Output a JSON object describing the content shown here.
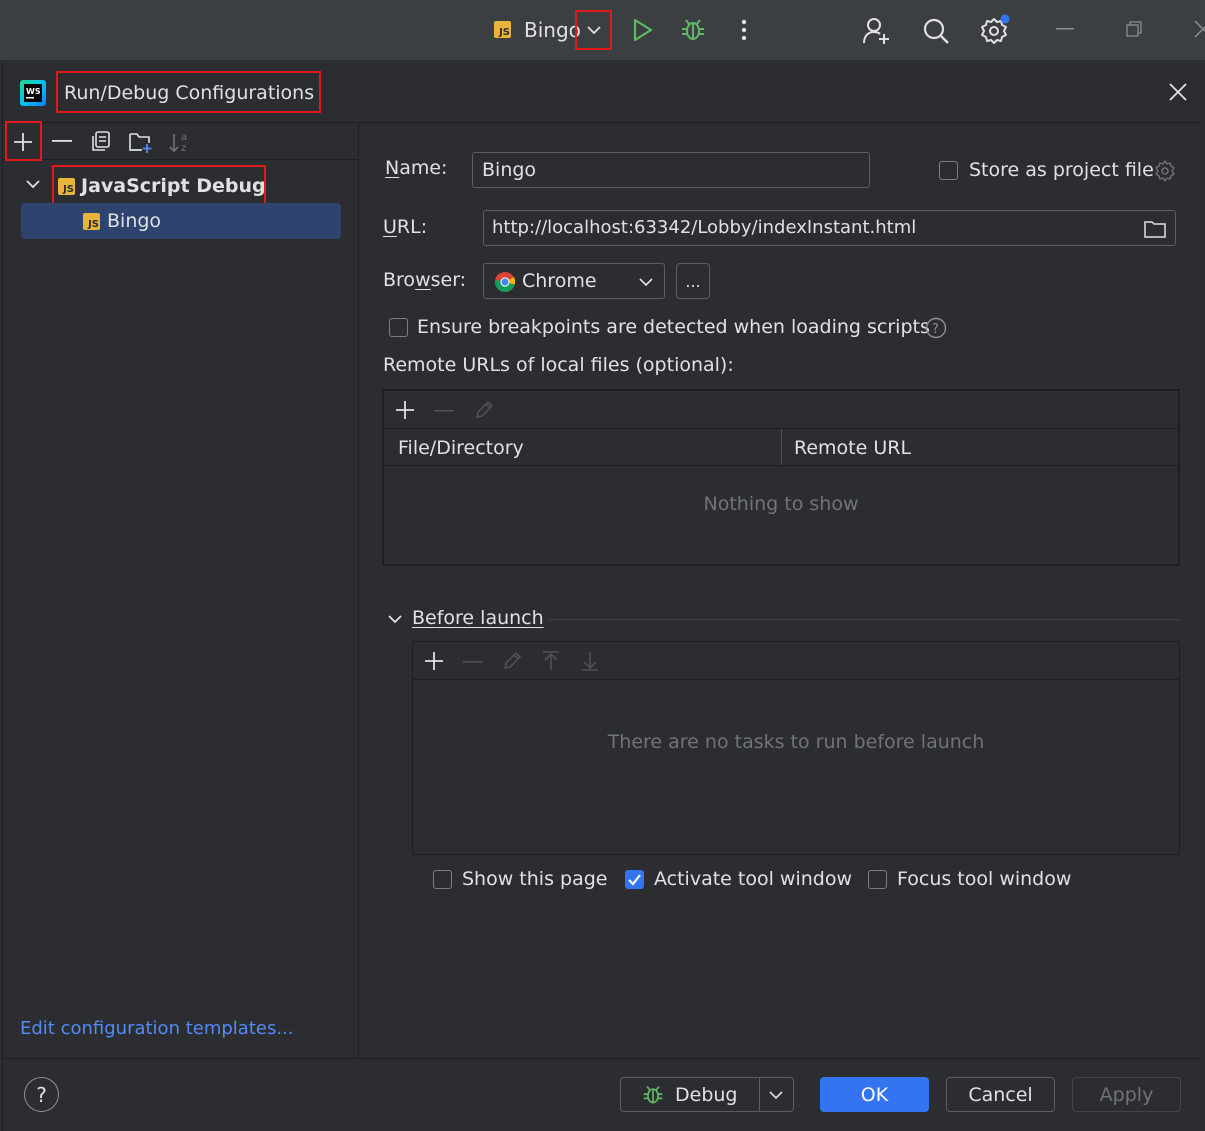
{
  "toolbar": {
    "run_config_label": "Bingo",
    "run_config_icon": "JS",
    "icons": [
      "chevron-down-icon",
      "run-icon",
      "debug-icon",
      "more-vertical-icon",
      "add-user-icon",
      "search-icon",
      "settings-icon",
      "minimize-icon",
      "restore-icon",
      "close-icon"
    ]
  },
  "dialog": {
    "title": "Run/Debug Configurations",
    "logo": "WS",
    "tree_toolbar": [
      "add-icon",
      "remove-icon",
      "copy-icon",
      "new-folder-icon",
      "sort-icon"
    ],
    "tree": {
      "group_label": "JavaScript Debug",
      "group_icon": "JS",
      "item_label": "Bingo",
      "item_icon": "JS"
    },
    "edit_templates_link": "Edit configuration templates...",
    "help_label": "?"
  },
  "form": {
    "name_label": "Name:",
    "name_value": "Bingo",
    "store_label": "Store as project file",
    "url_label": "URL:",
    "url_value": "http://localhost:63342/Lobby/indexInstant.html",
    "browser_label": "Browser:",
    "browser_value": "Chrome",
    "browse_button": "...",
    "ensure_label": "Ensure breakpoints are detected when loading scripts",
    "remote_urls_label": "Remote URLs of local files (optional):",
    "remote_table": {
      "columns": [
        "File/Directory",
        "Remote URL"
      ],
      "empty_text": "Nothing to show"
    },
    "before_launch_label": "Before launch",
    "before_launch_empty": "There are no tasks to run before launch",
    "show_page_label": "Show this page",
    "show_page_checked": false,
    "activate_label": "Activate tool window",
    "activate_checked": true,
    "focus_label": "Focus tool window",
    "focus_checked": false
  },
  "buttons": {
    "debug": "Debug",
    "ok": "OK",
    "cancel": "Cancel",
    "apply": "Apply"
  },
  "colors": {
    "accent": "#3574f0",
    "highlight": "#e0191b",
    "selection": "#2e436e",
    "run_green": "#5fb865",
    "link": "#548af7"
  }
}
